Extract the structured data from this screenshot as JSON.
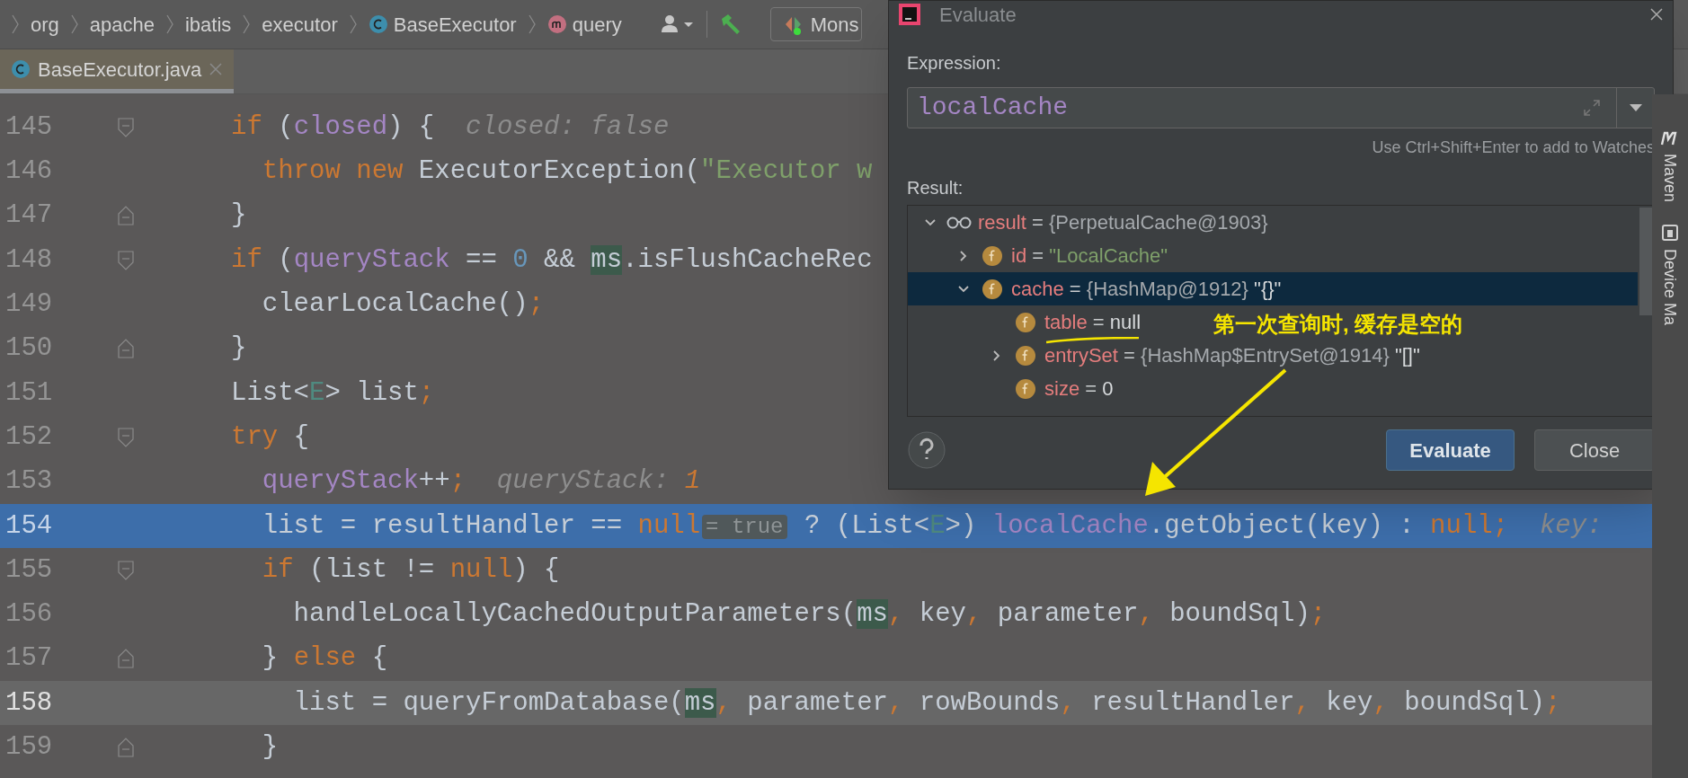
{
  "breadcrumbs": [
    {
      "label": "org",
      "kind": "package"
    },
    {
      "label": "apache",
      "kind": "package"
    },
    {
      "label": "ibatis",
      "kind": "package"
    },
    {
      "label": "executor",
      "kind": "package"
    },
    {
      "label": "BaseExecutor",
      "kind": "class"
    },
    {
      "label": "query",
      "kind": "method"
    }
  ],
  "run_config": {
    "label": "Mons"
  },
  "tabs": [
    {
      "label": "BaseExecutor.java",
      "selected": true
    }
  ],
  "editor": {
    "lines": [
      {
        "number": "145",
        "kind": "normal",
        "opens_block": true,
        "closes_block": false,
        "segments": [
          {
            "text": "if",
            "kind": "keyword"
          },
          {
            "text": " (",
            "kind": "plain"
          },
          {
            "text": "closed",
            "kind": "field"
          },
          {
            "text": ") {",
            "kind": "plain"
          },
          {
            "text": "  closed: false",
            "kind": "hint"
          }
        ]
      },
      {
        "number": "146",
        "kind": "normal",
        "opens_block": false,
        "closes_block": false,
        "segments": [
          {
            "text": "  throw new",
            "kind": "keyword"
          },
          {
            "text": " ExecutorException(",
            "kind": "plain"
          },
          {
            "text": "\"Executor w",
            "kind": "string"
          }
        ]
      },
      {
        "number": "147",
        "kind": "normal",
        "opens_block": false,
        "closes_block": true,
        "segments": [
          {
            "text": "}",
            "kind": "plain"
          }
        ]
      },
      {
        "number": "148",
        "kind": "normal",
        "opens_block": true,
        "closes_block": false,
        "segments": [
          {
            "text": "if",
            "kind": "keyword"
          },
          {
            "text": " (",
            "kind": "plain"
          },
          {
            "text": "queryStack",
            "kind": "field"
          },
          {
            "text": " == ",
            "kind": "plain"
          },
          {
            "text": "0",
            "kind": "number"
          },
          {
            "text": " && ",
            "kind": "plain"
          },
          {
            "text": "ms",
            "kind": "usage"
          },
          {
            "text": ".isFlushCacheRec",
            "kind": "plain"
          }
        ]
      },
      {
        "number": "149",
        "kind": "normal",
        "opens_block": false,
        "closes_block": false,
        "segments": [
          {
            "text": "  clearLocalCache()",
            "kind": "plain"
          },
          {
            "text": ";",
            "kind": "keyword"
          }
        ]
      },
      {
        "number": "150",
        "kind": "normal",
        "opens_block": false,
        "closes_block": true,
        "segments": [
          {
            "text": "}",
            "kind": "plain"
          }
        ]
      },
      {
        "number": "151",
        "kind": "normal",
        "opens_block": false,
        "closes_block": false,
        "segments": [
          {
            "text": "List<",
            "kind": "plain"
          },
          {
            "text": "E",
            "kind": "typeparam"
          },
          {
            "text": "> list",
            "kind": "plain"
          },
          {
            "text": ";",
            "kind": "keyword"
          }
        ]
      },
      {
        "number": "152",
        "kind": "normal",
        "opens_block": true,
        "closes_block": false,
        "segments": [
          {
            "text": "try",
            "kind": "keyword"
          },
          {
            "text": " {",
            "kind": "plain"
          }
        ]
      },
      {
        "number": "153",
        "kind": "normal",
        "opens_block": false,
        "closes_block": false,
        "segments": [
          {
            "text": "  queryStack",
            "kind": "field"
          },
          {
            "text": "++",
            "kind": "plain"
          },
          {
            "text": ";",
            "kind": "keyword"
          },
          {
            "text": "  queryStack: ",
            "kind": "hint"
          },
          {
            "text": "1",
            "kind": "hintvalue"
          }
        ]
      },
      {
        "number": "154",
        "kind": "execution",
        "opens_block": false,
        "closes_block": false,
        "segments": [
          {
            "text": "  list = resultHandler == ",
            "kind": "plain"
          },
          {
            "text": "null",
            "kind": "keyword"
          },
          {
            "text": "= true",
            "kind": "inlay"
          },
          {
            "text": " ? (List<",
            "kind": "plain"
          },
          {
            "text": "E",
            "kind": "typeparam"
          },
          {
            "text": ">) ",
            "kind": "plain"
          },
          {
            "text": "localCache",
            "kind": "field"
          },
          {
            "text": ".getObject(key) : ",
            "kind": "plain"
          },
          {
            "text": "null",
            "kind": "keyword"
          },
          {
            "text": ";",
            "kind": "keyword"
          },
          {
            "text": "  key:",
            "kind": "hint"
          }
        ]
      },
      {
        "number": "155",
        "kind": "normal",
        "opens_block": true,
        "closes_block": false,
        "segments": [
          {
            "text": "  if",
            "kind": "keyword"
          },
          {
            "text": " (list != ",
            "kind": "plain"
          },
          {
            "text": "null",
            "kind": "keyword"
          },
          {
            "text": ") {",
            "kind": "plain"
          }
        ]
      },
      {
        "number": "156",
        "kind": "normal",
        "opens_block": false,
        "closes_block": false,
        "segments": [
          {
            "text": "    handleLocallyCachedOutputParameters(",
            "kind": "plain"
          },
          {
            "text": "ms",
            "kind": "usage"
          },
          {
            "text": ",",
            "kind": "keyword"
          },
          {
            "text": " key",
            "kind": "plain"
          },
          {
            "text": ",",
            "kind": "keyword"
          },
          {
            "text": " parameter",
            "kind": "plain"
          },
          {
            "text": ",",
            "kind": "keyword"
          },
          {
            "text": " boundSql)",
            "kind": "plain"
          },
          {
            "text": ";",
            "kind": "keyword"
          }
        ]
      },
      {
        "number": "157",
        "kind": "normal",
        "opens_block": false,
        "closes_block": true,
        "segments": [
          {
            "text": "  } ",
            "kind": "plain"
          },
          {
            "text": "else",
            "kind": "keyword"
          },
          {
            "text": " {",
            "kind": "plain"
          }
        ]
      },
      {
        "number": "158",
        "kind": "current",
        "opens_block": false,
        "closes_block": false,
        "segments": [
          {
            "text": "    list = queryFromDatabase(",
            "kind": "plain"
          },
          {
            "text": "ms",
            "kind": "usage"
          },
          {
            "text": ",",
            "kind": "keyword"
          },
          {
            "text": " parameter",
            "kind": "plain"
          },
          {
            "text": ",",
            "kind": "keyword"
          },
          {
            "text": " rowBounds",
            "kind": "plain"
          },
          {
            "text": ",",
            "kind": "keyword"
          },
          {
            "text": " resultHandler",
            "kind": "plain"
          },
          {
            "text": ",",
            "kind": "keyword"
          },
          {
            "text": " key",
            "kind": "plain"
          },
          {
            "text": ",",
            "kind": "keyword"
          },
          {
            "text": " boundSql)",
            "kind": "plain"
          },
          {
            "text": ";",
            "kind": "keyword"
          }
        ]
      },
      {
        "number": "159",
        "kind": "normal",
        "opens_block": false,
        "closes_block": true,
        "segments": [
          {
            "text": "  }",
            "kind": "plain"
          }
        ]
      }
    ]
  },
  "side_tools": [
    {
      "label": "Maven",
      "kind": "maven"
    },
    {
      "label": "Device Ma",
      "kind": "device"
    }
  ],
  "dialog": {
    "title": "Evaluate",
    "expression_label": "Expression:",
    "expression": "localCache",
    "hint": "Use Ctrl+Shift+Enter to add to Watches",
    "result_label": "Result:",
    "tree": [
      {
        "kind": "watch",
        "name": "result",
        "operator": "=",
        "value": {
          "text": "{PerpetualCache@1903}",
          "kind": "object"
        },
        "selected": false,
        "expanded": true,
        "children": [
          {
            "kind": "field",
            "name": "id",
            "operator": "=",
            "value": {
              "text": "\"LocalCache\"",
              "kind": "string"
            },
            "selected": false,
            "expanded": false
          },
          {
            "kind": "field",
            "name": "cache",
            "operator": "=",
            "value": {
              "text": "{HashMap@1912}",
              "kind": "object"
            },
            "note": "\"{}\"",
            "selected": true,
            "expanded": true,
            "children": [
              {
                "kind": "field",
                "name": "table",
                "operator": "=",
                "value": {
                  "text": "null",
                  "kind": "primitive"
                },
                "selected": false,
                "underlined": true
              },
              {
                "kind": "field",
                "name": "entrySet",
                "operator": "=",
                "value": {
                  "text": "{HashMap$EntrySet@1914}",
                  "kind": "object"
                },
                "note": "\"[]\"",
                "selected": false,
                "expanded": false
              },
              {
                "kind": "field",
                "name": "size",
                "operator": "=",
                "value": {
                  "text": "0",
                  "kind": "primitive"
                },
                "selected": false
              }
            ]
          }
        ]
      }
    ],
    "buttons": [
      {
        "label": "Evaluate",
        "kind": "primary"
      },
      {
        "label": "Close",
        "kind": "secondary"
      }
    ]
  },
  "annotation": {
    "text": "第一次查询时, 缓存是空的"
  }
}
